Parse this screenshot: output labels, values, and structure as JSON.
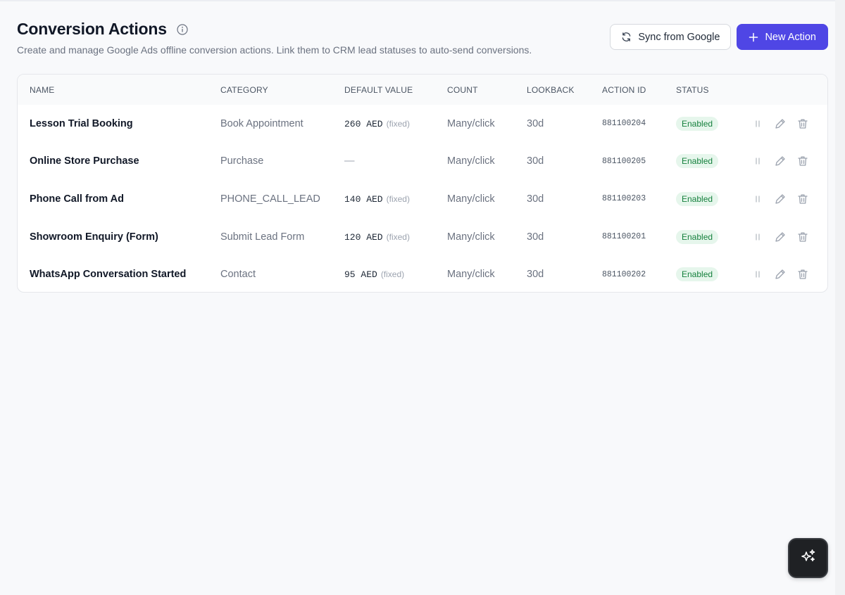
{
  "page": {
    "title": "Conversion Actions",
    "subtitle": "Create and manage Google Ads offline conversion actions. Link them to CRM lead statuses to auto-send conversions."
  },
  "toolbar": {
    "sync_label": "Sync from Google",
    "new_label": "New Action"
  },
  "table": {
    "headers": {
      "name": "NAME",
      "category": "CATEGORY",
      "default_value": "DEFAULT VALUE",
      "count": "COUNT",
      "lookback": "LOOKBACK",
      "action_id": "ACTION ID",
      "status": "STATUS"
    },
    "rows": [
      {
        "name": "Lesson Trial Booking",
        "category": "Book Appointment",
        "value": "260 AED",
        "value_note": "(fixed)",
        "count": "Many/click",
        "lookback": "30d",
        "action_id": "881100204",
        "status": "Enabled"
      },
      {
        "name": "Online Store Purchase",
        "category": "Purchase",
        "value": "—",
        "value_note": "",
        "count": "Many/click",
        "lookback": "30d",
        "action_id": "881100205",
        "status": "Enabled"
      },
      {
        "name": "Phone Call from Ad",
        "category": "PHONE_CALL_LEAD",
        "value": "140 AED",
        "value_note": "(fixed)",
        "count": "Many/click",
        "lookback": "30d",
        "action_id": "881100203",
        "status": "Enabled"
      },
      {
        "name": "Showroom Enquiry (Form)",
        "category": "Submit Lead Form",
        "value": "120 AED",
        "value_note": "(fixed)",
        "count": "Many/click",
        "lookback": "30d",
        "action_id": "881100201",
        "status": "Enabled"
      },
      {
        "name": "WhatsApp Conversation Started",
        "category": "Contact",
        "value": "95 AED",
        "value_note": "(fixed)",
        "count": "Many/click",
        "lookback": "30d",
        "action_id": "881100202",
        "status": "Enabled"
      }
    ]
  },
  "colors": {
    "primary": "#4f46e5",
    "status_enabled_bg": "#e6f6ec",
    "status_enabled_text": "#15803d",
    "background": "#f8f9fb"
  },
  "icons": {
    "info": "info-circle-icon",
    "sync": "refresh-icon",
    "new": "plus-icon",
    "pause": "pause-icon",
    "edit": "pencil-icon",
    "delete": "trash-icon",
    "assistant": "sparkles-icon"
  }
}
